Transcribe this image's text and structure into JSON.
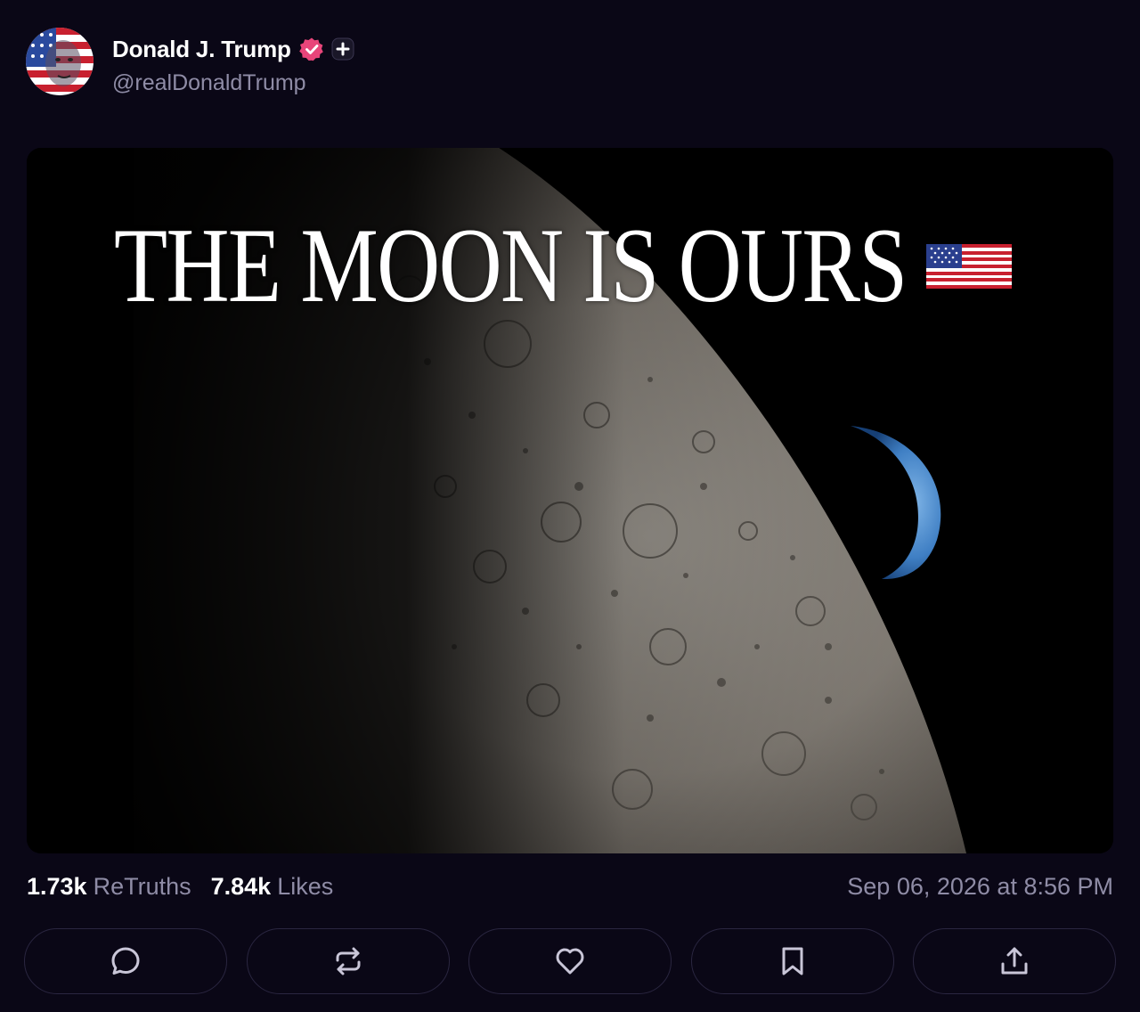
{
  "post": {
    "author": {
      "display_name": "Donald J. Trump",
      "handle": "@realDonaldTrump",
      "verified": true,
      "badges": [
        "verified-badge-icon",
        "plus-badge-icon"
      ]
    },
    "media": {
      "headline": "THE MOON IS OURS",
      "emoji": "us-flag-icon"
    },
    "stats": {
      "retruths_count": "1.73k",
      "retruths_label": "ReTruths",
      "likes_count": "7.84k",
      "likes_label": "Likes",
      "timestamp": "Sep 06, 2026 at 8:56 PM"
    },
    "actions": [
      {
        "name": "reply",
        "icon": "comment-icon"
      },
      {
        "name": "retruth",
        "icon": "repost-icon"
      },
      {
        "name": "like",
        "icon": "heart-icon"
      },
      {
        "name": "bookmark",
        "icon": "bookmark-icon"
      },
      {
        "name": "share",
        "icon": "share-icon"
      }
    ]
  },
  "colors": {
    "background": "#0a0716",
    "muted_text": "#8f8ca6",
    "verified_pink": "#e8457a",
    "button_border": "#2a2640"
  }
}
